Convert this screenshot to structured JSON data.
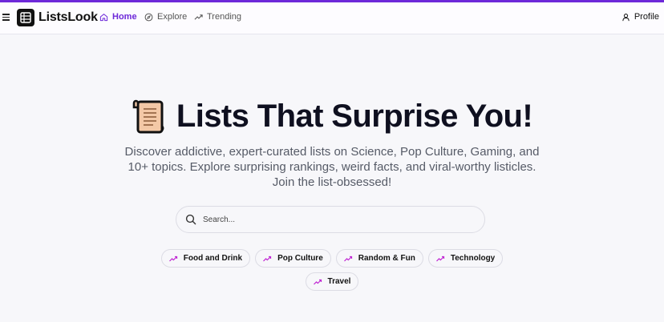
{
  "header": {
    "brand": "ListsLook",
    "nav": [
      {
        "label": "Home",
        "icon": "home-icon",
        "active": true
      },
      {
        "label": "Explore",
        "icon": "compass-icon"
      },
      {
        "label": "Trending",
        "icon": "trending-icon"
      }
    ],
    "profile_label": "Profile"
  },
  "hero": {
    "title": "Lists That Surprise You!",
    "subtitle": "Discover addictive, expert-curated lists on Science, Pop Culture, Gaming, and 10+ topics. Explore surprising rankings, weird facts, and viral-worthy listicles. Join the list-obsessed!"
  },
  "search": {
    "placeholder": "Search...",
    "value": ""
  },
  "categories": [
    {
      "label": "Food and Drink",
      "icon": "trending-icon"
    },
    {
      "label": "Pop Culture",
      "icon": "trending-icon"
    },
    {
      "label": "Random & Fun",
      "icon": "trending-icon"
    },
    {
      "label": "Technology",
      "icon": "trending-icon"
    },
    {
      "label": "Travel",
      "icon": "trending-icon"
    }
  ],
  "colors": {
    "accent": "#6d28d9",
    "background": "#f7f7fa",
    "title": "#0f1020",
    "chip_icon": "#c026d3"
  }
}
